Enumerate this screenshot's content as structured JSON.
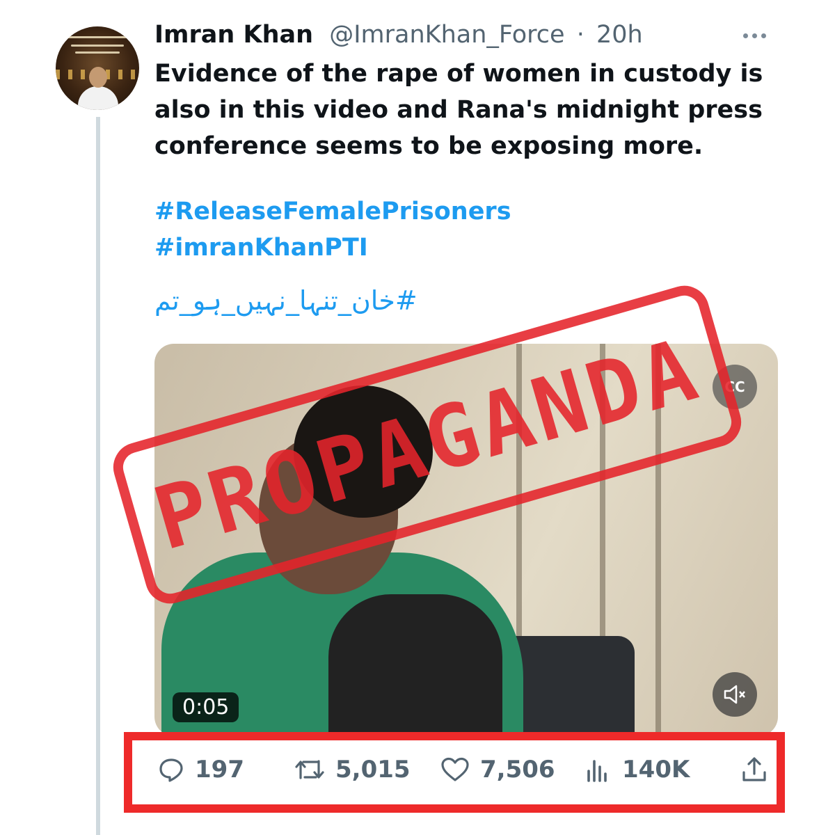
{
  "tweet": {
    "author_name": "Imran Khan",
    "handle": "@ImranKhan_Force",
    "separator": "·",
    "time": "20h",
    "text": "Evidence of the rape of women in custody is also in this video and Rana's midnight press conference seems to be exposing more.",
    "hashtags": [
      "#ReleaseFemalePrisoners",
      "#imranKhanPTI"
    ],
    "urdu_hashtag": "#خان_تنہا_نہیں_ہو_تم"
  },
  "video": {
    "duration": "0:05",
    "cc_label": "CC"
  },
  "stamp": {
    "text": "PROPAGANDA",
    "color": "#e5242b"
  },
  "actions": {
    "replies": "197",
    "retweets": "5,015",
    "likes": "7,506",
    "views": "140K"
  },
  "icons": [
    "more-icon",
    "reply-icon",
    "retweet-icon",
    "like-icon",
    "views-icon",
    "share-icon",
    "closed-captions-icon",
    "mute-icon"
  ],
  "colors": {
    "accent": "#1d9bf0",
    "muted_text": "#536471",
    "highlight_box": "#ee2a2a"
  }
}
